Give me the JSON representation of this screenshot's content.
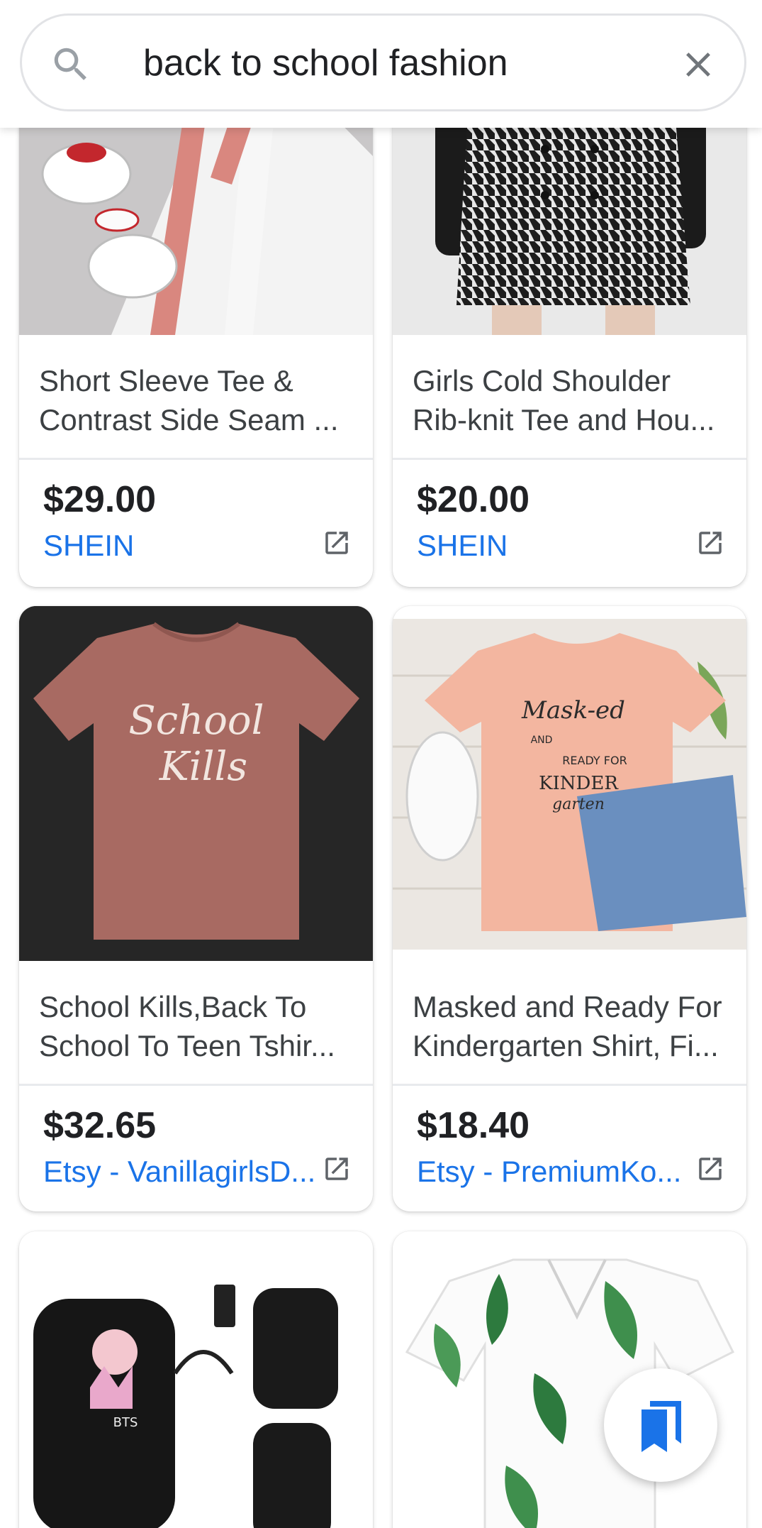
{
  "search": {
    "query": "back to school fashion",
    "search_icon": "search-icon",
    "clear_icon": "close-icon"
  },
  "colors": {
    "link": "#1a73e8",
    "price": "#202124",
    "title": "#3c4043",
    "fab_icon": "#1a73e8"
  },
  "products": [
    {
      "title_line1": "Short Sleeve Tee &",
      "title_line2": "Contrast Side Seam ...",
      "price": "$29.00",
      "seller": "SHEIN",
      "image": "white sneakers and white pants with pink text stripe"
    },
    {
      "title_line1": "Girls Cold Shoulder",
      "title_line2": "Rib-knit Tee and Hou...",
      "price": "$20.00",
      "seller": "SHEIN",
      "image": "black top with houndstooth skirt"
    },
    {
      "title_line1": "School Kills,Back To",
      "title_line2": "School To Teen Tshir...",
      "price": "$32.65",
      "seller": "Etsy - VanillagirlsD...",
      "image": "mauve t-shirt on dark background",
      "print_line1": "School",
      "print_line2": "Kills"
    },
    {
      "title_line1": "Masked and Ready For",
      "title_line2": "Kindergarten Shirt, Fi...",
      "price": "$18.40",
      "seller": "Etsy - PremiumKo...",
      "image": "peach t-shirt with sneakers and denim shorts",
      "print_line1": "Mask-ed",
      "print_line2": "AND",
      "print_line3": "READY FOR",
      "print_line4": "KINDER",
      "print_line5": "garten"
    },
    {
      "image": "black backpacks with pink pom pom and headphones",
      "print_line1": "BTS"
    },
    {
      "image": "white dress with green leaf print"
    }
  ],
  "fab": {
    "icon": "bookmarks-icon"
  }
}
